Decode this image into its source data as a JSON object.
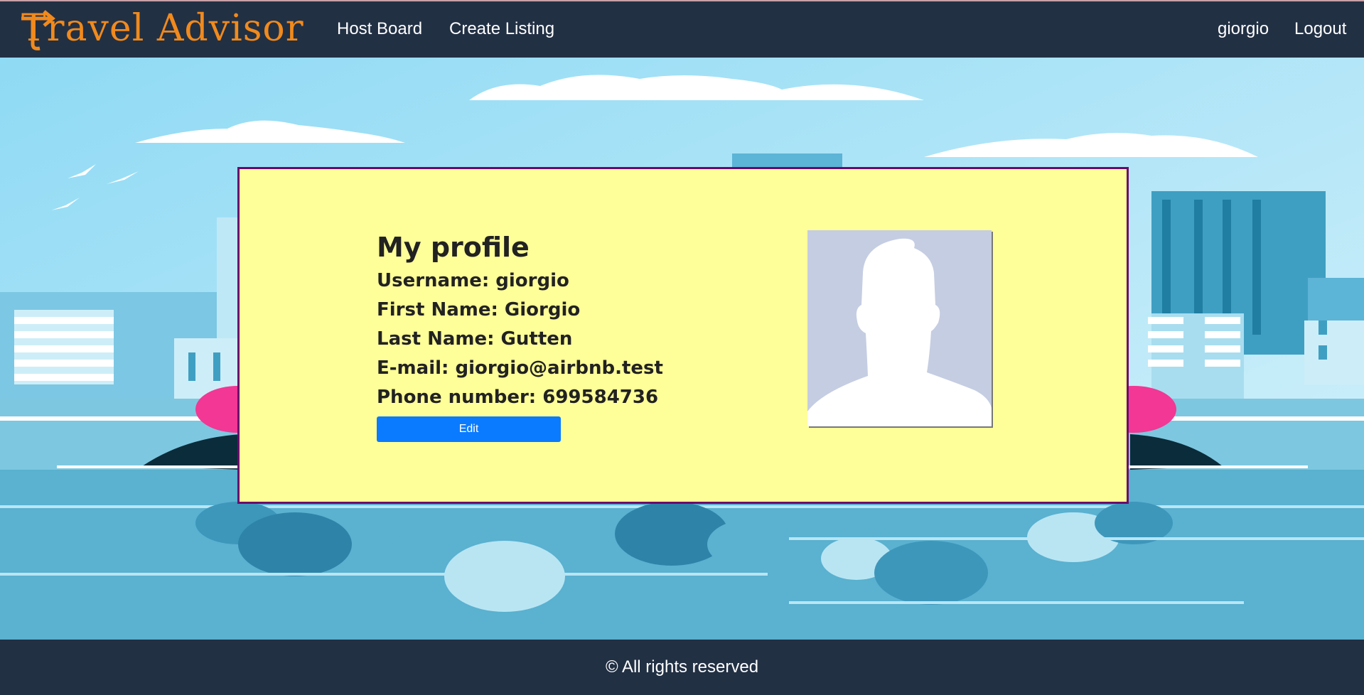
{
  "brand": {
    "name": "Travel Advisor",
    "color": "#f18a1c"
  },
  "nav": {
    "left": [
      {
        "label": "Host Board"
      },
      {
        "label": "Create Listing"
      }
    ],
    "right": [
      {
        "label": "giorgio"
      },
      {
        "label": "Logout"
      }
    ]
  },
  "profile": {
    "title": "My profile",
    "username": "Username: giorgio",
    "first_name": "First Name: Giorgio",
    "last_name": "Last Name: Gutten",
    "email": "E-mail: giorgio@airbnb.test",
    "phone": "Phone number: 699584736",
    "edit_label": "Edit",
    "avatar_icon": "default-user-silhouette-icon"
  },
  "footer": {
    "text": "© All rights reserved"
  },
  "colors": {
    "navbar": "#223044",
    "card_bg": "#ffff99",
    "card_border": "#6b0a6b",
    "button": "#0a7bff"
  }
}
